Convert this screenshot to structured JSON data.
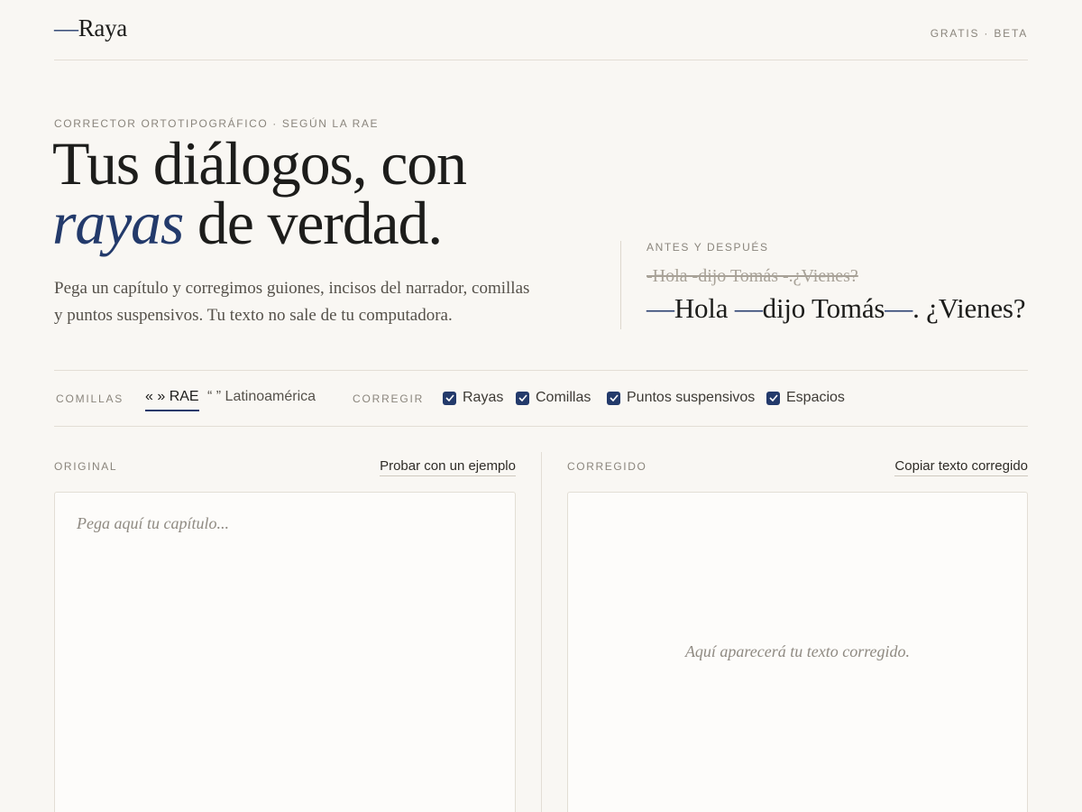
{
  "brand": {
    "dash": "—",
    "name": "Raya",
    "badge": "GRATIS · BETA"
  },
  "hero": {
    "eyebrow": "CORRECTOR ORTOTIPOGRÁFICO · SEGÚN LA RAE",
    "title_line1": "Tus diálogos, con",
    "title_accent": "rayas",
    "title_rest": " de verdad.",
    "lede": "Pega un capítulo y corregimos guiones, incisos del narrador, comillas y puntos suspensivos. Tu texto no sale de tu computadora."
  },
  "before_after": {
    "label": "ANTES Y DESPUÉS",
    "before": "-Hola -dijo Tomás -.¿Vienes?",
    "after_parts": [
      "—",
      "Hola ",
      "—",
      "dijo Tomás",
      "—",
      ". ¿Vienes?"
    ]
  },
  "options": {
    "quotes_label": "COMILLAS",
    "quotes": [
      {
        "label": "« » RAE",
        "active": true
      },
      {
        "label": "“ ” Latinoamérica",
        "active": false
      }
    ],
    "fix_label": "CORREGIR",
    "fixes": [
      {
        "label": "Rayas",
        "checked": true
      },
      {
        "label": "Comillas",
        "checked": true
      },
      {
        "label": "Puntos suspensivos",
        "checked": true
      },
      {
        "label": "Espacios",
        "checked": true
      }
    ]
  },
  "original": {
    "label": "ORIGINAL",
    "action": "Probar con un ejemplo",
    "placeholder": "Pega aquí tu capítulo..."
  },
  "corrected": {
    "label": "CORREGIDO",
    "action": "Copiar texto corregido",
    "empty_message": "Aquí aparecerá tu texto corregido."
  },
  "colors": {
    "accent": "#233a6b",
    "background": "#f9f7f3",
    "muted": "#8a857c"
  }
}
